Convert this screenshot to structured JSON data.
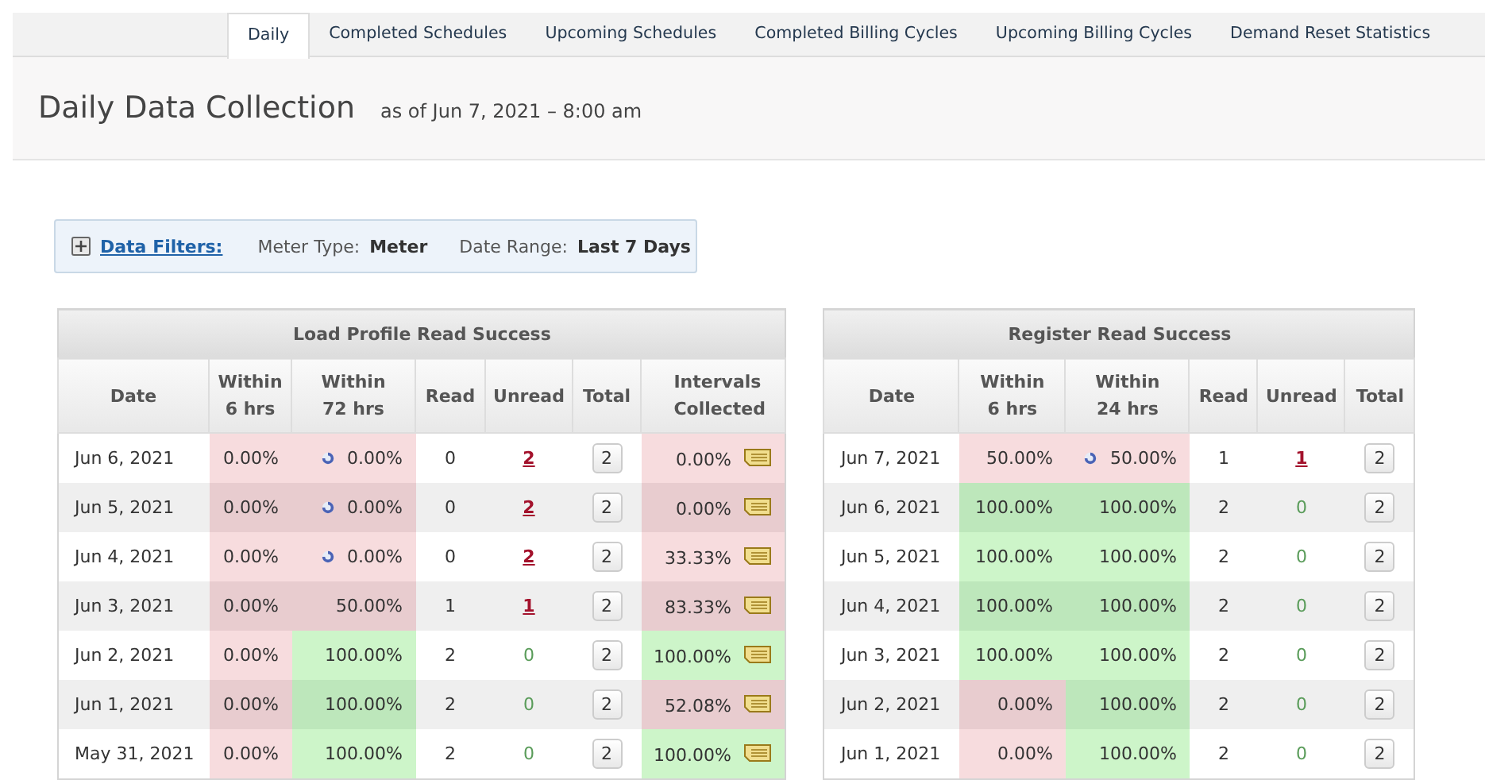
{
  "tabs": [
    {
      "label": "Daily",
      "selected": true
    },
    {
      "label": "Completed Schedules",
      "selected": false
    },
    {
      "label": "Upcoming Schedules",
      "selected": false
    },
    {
      "label": "Completed Billing Cycles",
      "selected": false
    },
    {
      "label": "Upcoming Billing Cycles",
      "selected": false
    },
    {
      "label": "Demand Reset Statistics",
      "selected": false
    }
  ],
  "header": {
    "title": "Daily Data Collection",
    "subtitle": "as of Jun 7, 2021 – 8:00 am"
  },
  "filters": {
    "expanded": false,
    "link": "Data Filters:",
    "items": [
      {
        "label": "Meter Type:",
        "value": "Meter"
      },
      {
        "label": "Date Range:",
        "value": "Last 7 Days"
      }
    ]
  },
  "tables": [
    {
      "title": "Load Profile Read Success",
      "columns": [
        "Date",
        "Within 6 hrs",
        "Within 72 hrs",
        "Read",
        "Unread",
        "Total",
        "Intervals Collected"
      ],
      "rows": [
        {
          "date": "Jun 6, 2021",
          "within_a": {
            "text": "0.00%",
            "success": false
          },
          "within_b": {
            "text": "0.00%",
            "success": false,
            "pending": true
          },
          "read": "0",
          "unread": {
            "text": "2",
            "link": true
          },
          "total": "2",
          "intervals": {
            "text": "0.00%",
            "success": false
          }
        },
        {
          "date": "Jun 5, 2021",
          "within_a": {
            "text": "0.00%",
            "success": false
          },
          "within_b": {
            "text": "0.00%",
            "success": false,
            "pending": true
          },
          "read": "0",
          "unread": {
            "text": "2",
            "link": true
          },
          "total": "2",
          "intervals": {
            "text": "0.00%",
            "success": false
          }
        },
        {
          "date": "Jun 4, 2021",
          "within_a": {
            "text": "0.00%",
            "success": false
          },
          "within_b": {
            "text": "0.00%",
            "success": false,
            "pending": true
          },
          "read": "0",
          "unread": {
            "text": "2",
            "link": true
          },
          "total": "2",
          "intervals": {
            "text": "33.33%",
            "success": false
          }
        },
        {
          "date": "Jun 3, 2021",
          "within_a": {
            "text": "0.00%",
            "success": false
          },
          "within_b": {
            "text": "50.00%",
            "success": false,
            "pending": false
          },
          "read": "1",
          "unread": {
            "text": "1",
            "link": true
          },
          "total": "2",
          "intervals": {
            "text": "83.33%",
            "success": false
          }
        },
        {
          "date": "Jun 2, 2021",
          "within_a": {
            "text": "0.00%",
            "success": false
          },
          "within_b": {
            "text": "100.00%",
            "success": true,
            "pending": false
          },
          "read": "2",
          "unread": {
            "text": "0",
            "link": false
          },
          "total": "2",
          "intervals": {
            "text": "100.00%",
            "success": true
          }
        },
        {
          "date": "Jun 1, 2021",
          "within_a": {
            "text": "0.00%",
            "success": false
          },
          "within_b": {
            "text": "100.00%",
            "success": true,
            "pending": false
          },
          "read": "2",
          "unread": {
            "text": "0",
            "link": false
          },
          "total": "2",
          "intervals": {
            "text": "52.08%",
            "success": false
          }
        },
        {
          "date": "May 31, 2021",
          "within_a": {
            "text": "0.00%",
            "success": false
          },
          "within_b": {
            "text": "100.00%",
            "success": true,
            "pending": false
          },
          "read": "2",
          "unread": {
            "text": "0",
            "link": false
          },
          "total": "2",
          "intervals": {
            "text": "100.00%",
            "success": true
          }
        }
      ]
    },
    {
      "title": "Register Read Success",
      "columns": [
        "Date",
        "Within 6 hrs",
        "Within 24 hrs",
        "Read",
        "Unread",
        "Total"
      ],
      "rows": [
        {
          "date": "Jun 7, 2021",
          "within_a": {
            "text": "50.00%",
            "success": false
          },
          "within_b": {
            "text": "50.00%",
            "success": false,
            "pending": true
          },
          "read": "1",
          "unread": {
            "text": "1",
            "link": true
          },
          "total": "2"
        },
        {
          "date": "Jun 6, 2021",
          "within_a": {
            "text": "100.00%",
            "success": true
          },
          "within_b": {
            "text": "100.00%",
            "success": true,
            "pending": false
          },
          "read": "2",
          "unread": {
            "text": "0",
            "link": false
          },
          "total": "2"
        },
        {
          "date": "Jun 5, 2021",
          "within_a": {
            "text": "100.00%",
            "success": true
          },
          "within_b": {
            "text": "100.00%",
            "success": true,
            "pending": false
          },
          "read": "2",
          "unread": {
            "text": "0",
            "link": false
          },
          "total": "2"
        },
        {
          "date": "Jun 4, 2021",
          "within_a": {
            "text": "100.00%",
            "success": true
          },
          "within_b": {
            "text": "100.00%",
            "success": true,
            "pending": false
          },
          "read": "2",
          "unread": {
            "text": "0",
            "link": false
          },
          "total": "2"
        },
        {
          "date": "Jun 3, 2021",
          "within_a": {
            "text": "100.00%",
            "success": true
          },
          "within_b": {
            "text": "100.00%",
            "success": true,
            "pending": false
          },
          "read": "2",
          "unread": {
            "text": "0",
            "link": false
          },
          "total": "2"
        },
        {
          "date": "Jun 2, 2021",
          "within_a": {
            "text": "0.00%",
            "success": false
          },
          "within_b": {
            "text": "100.00%",
            "success": true,
            "pending": false
          },
          "read": "2",
          "unread": {
            "text": "0",
            "link": false
          },
          "total": "2"
        },
        {
          "date": "Jun 1, 2021",
          "within_a": {
            "text": "0.00%",
            "success": false
          },
          "within_b": {
            "text": "100.00%",
            "success": true,
            "pending": false
          },
          "read": "2",
          "unread": {
            "text": "0",
            "link": false
          },
          "total": "2"
        }
      ]
    }
  ]
}
